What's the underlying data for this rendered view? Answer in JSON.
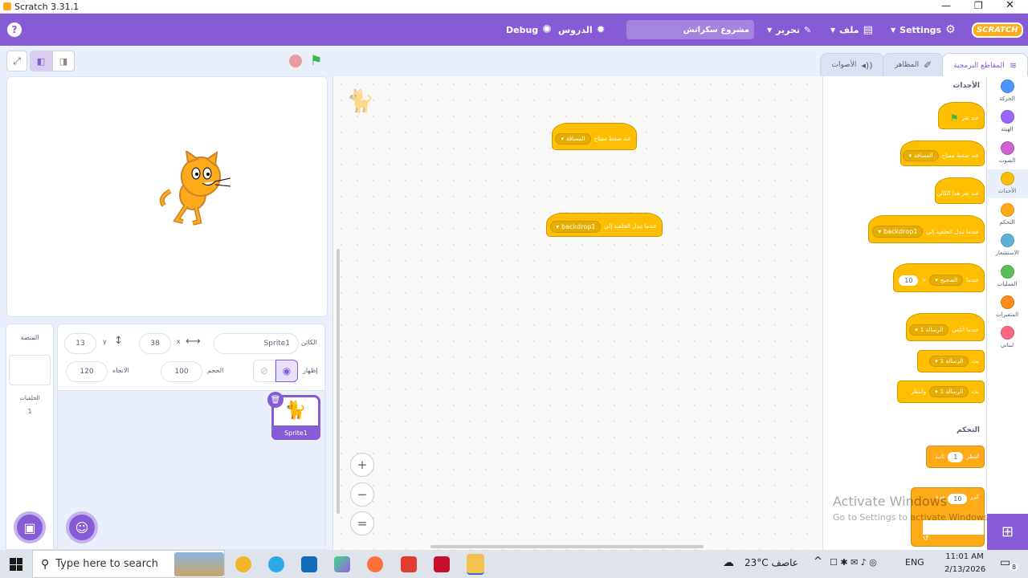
{
  "window": {
    "title": "Scratch 3.31.1"
  },
  "menubar": {
    "settings": "Settings",
    "file": "ملف",
    "edit": "تحرير",
    "project_title": "مشروع سكراتش",
    "tutorials": "الدروس",
    "debug": "Debug",
    "logo": "SCRATCH"
  },
  "tabs": {
    "code": "المقاطع البرمجية",
    "costumes": "المظاهر",
    "sounds": "الأصوات"
  },
  "categories": [
    {
      "label": "الحركة",
      "color": "#4C97FF"
    },
    {
      "label": "الهيئة",
      "color": "#9966FF"
    },
    {
      "label": "الصوت",
      "color": "#CF63CF"
    },
    {
      "label": "الأحداث",
      "color": "#FFBF00"
    },
    {
      "label": "التحكم",
      "color": "#FFAB19"
    },
    {
      "label": "الاستشعار",
      "color": "#5CB1D6"
    },
    {
      "label": "العمليات",
      "color": "#59C059"
    },
    {
      "label": "المتغيرات",
      "color": "#FF8C1A"
    },
    {
      "label": "لبناتي",
      "color": "#FF6680"
    }
  ],
  "palette": {
    "events_heading": "الأحداث",
    "control_heading": "التحكم",
    "block_when_flag": "عند نقر",
    "block_when_key": "عند ضغط مفتاح",
    "key_option": "المسافة",
    "block_when_sprite_clicked": "عند نقر هذا الكائن",
    "block_when_backdrop": "عندما تبدل الخلفية إلى",
    "backdrop_option": "backdrop1",
    "block_when_greater": "عندما",
    "loudness_option": "الضجيج",
    "greater_sign": ">",
    "greater_value": "10",
    "block_when_receive": "عندما أتلقى",
    "message_option": "الرسالة 1",
    "block_broadcast": "بث",
    "block_broadcast_wait": "بث",
    "broadcast_wait_suffix": "وانتظر",
    "block_wait": "انتظر",
    "wait_value": "1",
    "wait_unit": "ثانية",
    "block_repeat": "كرر",
    "repeat_value": "10",
    "repeat_unit": "مرة"
  },
  "workspace": {
    "block1_text": "عند ضغط مفتاح",
    "block1_option": "المسافة",
    "block2_text": "عندما تبدل الخلفية إلى",
    "block2_option": "backdrop1",
    "zoom_in": "+",
    "zoom_out": "−",
    "zoom_reset": "="
  },
  "sprite_info": {
    "sprite_label": "الكائن",
    "sprite_name": "Sprite1",
    "x_label": "x",
    "x_value": "38",
    "y_label": "y",
    "y_value": "13",
    "show_label": "إظهار",
    "size_label": "الحجم",
    "size_value": "100",
    "direction_label": "الاتجاه",
    "direction_value": "120"
  },
  "stage_panel": {
    "title": "المنصة",
    "backdrops_label": "الخلفيات",
    "backdrops_count": "1"
  },
  "sprites": [
    {
      "name": "Sprite1"
    }
  ],
  "watermark": {
    "line1": "Activate Windows",
    "line2": "Go to Settings to activate Windows."
  },
  "taskbar": {
    "search_placeholder": "Type here to search",
    "weather": "23°C عاصف",
    "language": "ENG",
    "time": "11:01 AM",
    "date": "2/13/2026",
    "notifications": "8"
  }
}
